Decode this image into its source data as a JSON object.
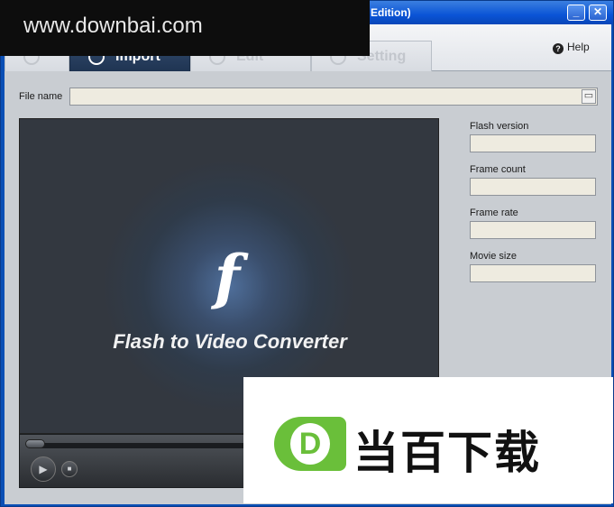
{
  "window": {
    "title": "Edition)",
    "minimize_label": "_",
    "close_label": "✕"
  },
  "tabs": [
    {
      "label": "Import",
      "active": true
    },
    {
      "label": "Edit",
      "active": false
    },
    {
      "label": "Setting",
      "active": false
    }
  ],
  "help": {
    "icon": "help-icon",
    "label": "Help"
  },
  "file": {
    "label": "File name",
    "value": ""
  },
  "info": {
    "flash_version_label": "Flash version",
    "frame_count_label": "Frame count",
    "frame_rate_label": "Frame rate",
    "movie_size_label": "Movie size"
  },
  "preview": {
    "caption": "Flash to Video Converter",
    "logo_glyph": "f"
  },
  "player": {
    "play_glyph": "▶",
    "stop_glyph": "■"
  },
  "overlay": {
    "watermark": "www.downbai.com",
    "ad_badge": "D",
    "ad_text": "当百下载",
    "ad_color": "#6abf3a"
  }
}
